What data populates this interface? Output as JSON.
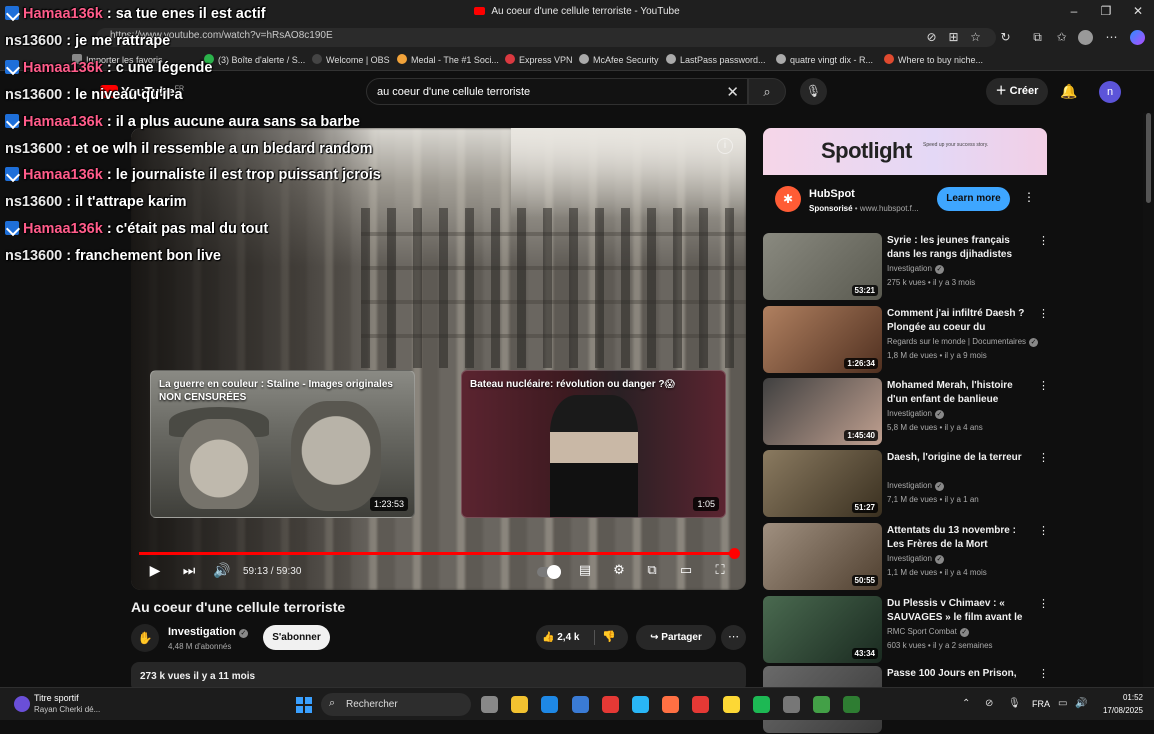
{
  "window": {
    "title": "Au coeur d'une cellule terroriste - YouTube",
    "url": "https://www.youtube.com/watch?v=hRsAO8c190E"
  },
  "bookmarks": [
    {
      "label": "Importer les favoris",
      "color": "#888888"
    },
    {
      "label": "(3) Boîte d'alerte / S...",
      "color": "#2bb34b"
    },
    {
      "label": "Welcome | OBS",
      "color": "#444444"
    },
    {
      "label": "Medal - The #1 Soci...",
      "color": "#f2a33a"
    },
    {
      "label": "Express VPN",
      "color": "#da3940"
    },
    {
      "label": "McAfee Security",
      "color": "#aaaaaa"
    },
    {
      "label": "LastPass password...",
      "color": "#aaaaaa"
    },
    {
      "label": "quatre vingt dix - R...",
      "color": "#aaaaaa"
    },
    {
      "label": "Where to buy niche...",
      "color": "#e04a2f"
    }
  ],
  "youtube": {
    "logo": "YouTube",
    "logo_region": "FR",
    "search_value": "au coeur d'une cellule terroriste",
    "create_label": "Créer",
    "avatar_letter": "n"
  },
  "player": {
    "current_time": "59:13 / 59:30",
    "progress": 0.995,
    "endcards": [
      {
        "title": "La guerre en couleur : Staline - Images originales NON CENSURÉES",
        "duration": "1:23:53"
      },
      {
        "title": "Bateau nucléaire: révolution ou danger ?😱",
        "duration": "1:05"
      }
    ]
  },
  "video": {
    "title": "Au coeur d'une cellule terroriste",
    "channel": "Investigation",
    "subscribers": "4,48 M d'abonnés",
    "subscribe_label": "S'abonner",
    "likes": "2,4 k",
    "share_label": "Partager",
    "stats": "273 k vues  il y a 11 mois"
  },
  "ad": {
    "banner_title": "Spotlight",
    "banner_sub": "Speed up your success story.",
    "advertiser": "HubSpot",
    "sponsored": "Sponsorisé",
    "domain": "www.hubspot.f...",
    "cta": "Learn more"
  },
  "recommendations": [
    {
      "title": "Syrie : les jeunes français dans les rangs djihadistes",
      "channel": "Investigation",
      "meta": "275 k vues • il y a 3 mois",
      "duration": "53:21",
      "colors": [
        "#8a8a80",
        "#5a5a50"
      ]
    },
    {
      "title": "Comment j'ai infiltré Daesh ? Plongée au coeur du terrorism...",
      "channel": "Regards sur le monde | Documentaires",
      "meta": "1,8 M de vues • il y a 9 mois",
      "duration": "1:26:34",
      "colors": [
        "#b08060",
        "#503020"
      ]
    },
    {
      "title": "Mohamed Merah, l'histoire d'un enfant de banlieue devenu ...",
      "channel": "Investigation",
      "meta": "5,8 M de vues • il y a 4 ans",
      "duration": "1:45:40",
      "colors": [
        "#404040",
        "#c0a090"
      ]
    },
    {
      "title": "Daesh, l'origine de la terreur",
      "channel": "Investigation",
      "meta": "7,1 M de vues • il y a 1 an",
      "duration": "51:27",
      "colors": [
        "#8a7a60",
        "#3a3020"
      ]
    },
    {
      "title": "Attentats du 13 novembre : Les Frères de la Mort",
      "channel": "Investigation",
      "meta": "1,1 M de vues • il y a 4 mois",
      "duration": "50:55",
      "colors": [
        "#a09080",
        "#504030"
      ]
    },
    {
      "title": "Du Plessis v Chimaev : « SAUVAGES » le film avant le ...",
      "channel": "RMC Sport Combat",
      "meta": "603 k vues • il y a 2 semaines",
      "duration": "43:34",
      "colors": [
        "#4a6a50",
        "#1a2a20"
      ]
    },
    {
      "title": "Passe 100 Jours en Prison,",
      "channel": "",
      "meta": "",
      "duration": "",
      "colors": [
        "#6a6a6a",
        "#3a3a3a"
      ]
    }
  ],
  "chat": [
    {
      "user": "Hamaa136k",
      "text": ": sa tue enes il est actif",
      "type": "h"
    },
    {
      "user": "ns13600",
      "text": ": je me rattrape",
      "type": "n"
    },
    {
      "user": "Hamaa136k",
      "text": ": c une légende",
      "type": "h"
    },
    {
      "user": "ns13600",
      "text": ": le niveau qu'il a",
      "type": "n"
    },
    {
      "user": "Hamaa136k",
      "text": ": il a plus aucune aura sans sa barbe",
      "type": "h"
    },
    {
      "user": "ns13600",
      "text": ": et oe wlh il ressemble a un bledard random",
      "type": "n"
    },
    {
      "user": "Hamaa136k",
      "text": ": le journaliste il est trop puissant jcrois",
      "type": "h"
    },
    {
      "user": "ns13600",
      "text": ": il t'attrape karim",
      "type": "n"
    },
    {
      "user": "Hamaa136k",
      "text": ": c'était pas mal du tout",
      "type": "h"
    },
    {
      "user": "ns13600",
      "text": ": franchement bon live",
      "type": "n"
    }
  ],
  "taskbar": {
    "widget_title": "Titre sportif",
    "widget_sub": "Rayan Cherki dé...",
    "search_placeholder": "Rechercher",
    "lang": "FRA",
    "time": "01:52",
    "date": "17/08/2025",
    "apps": [
      "#888888",
      "#f2c230",
      "#1e88e5",
      "#3a7bd5",
      "#e53935",
      "#29b6f6",
      "#ff7043",
      "#e53935",
      "#fdd835",
      "#1db954",
      "#777777",
      "#43a047",
      "#2e7d32"
    ]
  }
}
